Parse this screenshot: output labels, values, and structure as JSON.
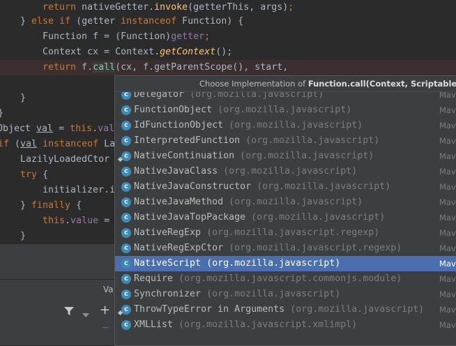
{
  "code": {
    "line1": {
      "kw": "return ",
      "rest": "nativeGetter.",
      "fn": "invoke",
      "args": "(getterThis, args)",
      "end": ";"
    },
    "line2": {
      "brace": "} ",
      "kw1": "else if ",
      "open": "(getter ",
      "kw2": "instanceof ",
      "type": "Function) {"
    },
    "line3": {
      "type": "Function f = (Function)",
      "var": "getter",
      "end": ";"
    },
    "line4": {
      "type": "Context cx = Context.",
      "fn": "getContext",
      "end": "();"
    },
    "line5": {
      "kw": "return ",
      "pre": "f.",
      "hl": "call",
      "args": "(cx, f.getParentScope(), start,",
      "end": ""
    },
    "line6": "}",
    "line7": "}",
    "line8": {
      "pre": "Object ",
      "var": "val",
      "mid": " = ",
      "kw": "this",
      "dot": ".",
      "fld": "val"
    },
    "line9": {
      "kw": "if ",
      "open": "(",
      "var": "val",
      "mid": " ",
      "kw2": "instanceof ",
      "rest": "La"
    },
    "line10": "LazilyLoadedCtor",
    "line11": {
      "kw": "try ",
      "rest": "{"
    },
    "line12": "initializer.i",
    "line13": {
      "brace": "} ",
      "kw": "finally ",
      "rest": "{"
    },
    "line14": {
      "kw": "this",
      "dot": ".",
      "fld": "value",
      "rest": " ="
    },
    "line15": "}"
  },
  "popup": {
    "header_prefix": "Choose Implementation of ",
    "header_method": "Function.call(Context, Scriptable, Scripta",
    "items": [
      {
        "name": "Delegator",
        "pkg": "(org.mozilla.javascript)",
        "source": "Mave",
        "icon": "class-icon"
      },
      {
        "name": "FunctionObject",
        "pkg": "(org.mozilla.javascript)",
        "source": "Mave",
        "icon": "class-icon"
      },
      {
        "name": "IdFunctionObject",
        "pkg": "(org.mozilla.javascript)",
        "source": "Mave",
        "icon": "class-icon"
      },
      {
        "name": "InterpretedFunction",
        "pkg": "(org.mozilla.javascript)",
        "source": "Mave",
        "icon": "class-icon"
      },
      {
        "name": "NativeContinuation",
        "pkg": "(org.mozilla.javascript)",
        "source": "Mave",
        "icon": "pinned-class-icon"
      },
      {
        "name": "NativeJavaClass",
        "pkg": "(org.mozilla.javascript)",
        "source": "Mave",
        "icon": "class-icon"
      },
      {
        "name": "NativeJavaConstructor",
        "pkg": "(org.mozilla.javascript)",
        "source": "Mave",
        "icon": "class-icon"
      },
      {
        "name": "NativeJavaMethod",
        "pkg": "(org.mozilla.javascript)",
        "source": "Mave",
        "icon": "class-icon"
      },
      {
        "name": "NativeJavaTopPackage",
        "pkg": "(org.mozilla.javascript)",
        "source": "Mave",
        "icon": "class-icon"
      },
      {
        "name": "NativeRegExp",
        "pkg": "(org.mozilla.javascript.regexp)",
        "source": "Mave",
        "icon": "class-icon"
      },
      {
        "name": "NativeRegExpCtor",
        "pkg": "(org.mozilla.javascript.regexp)",
        "source": "Mave",
        "icon": "class-icon"
      },
      {
        "name": "NativeScript",
        "pkg": "(org.mozilla.javascript)",
        "source": "Mave",
        "icon": "class-icon",
        "selected": true
      },
      {
        "name": "Require",
        "pkg": "(org.mozilla.javascript.commonjs.module)",
        "source": "Mave",
        "icon": "class-icon"
      },
      {
        "name": "Synchronizer",
        "pkg": "(org.mozilla.javascript)",
        "source": "Mave",
        "icon": "class-icon"
      },
      {
        "name": "ThrowTypeError in Arguments",
        "pkg": "(org.mozilla.javascript)",
        "source": "Mave",
        "icon": "pinned-class-icon"
      },
      {
        "name": "XMLList",
        "pkg": "(org.mozilla.javascript.xmlimpl)",
        "source": "Mave",
        "icon": "class-icon"
      }
    ]
  },
  "bottom": {
    "tab_label": "Va",
    "plus_glyph": "+",
    "minus_glyph": "−"
  },
  "colors": {
    "editor_bg": "#2b2b2b",
    "popup_bg": "#3c3f41",
    "selection": "#4b6eaf",
    "keyword": "#cc7832",
    "method": "#ffc66d",
    "field": "#9876aa"
  }
}
